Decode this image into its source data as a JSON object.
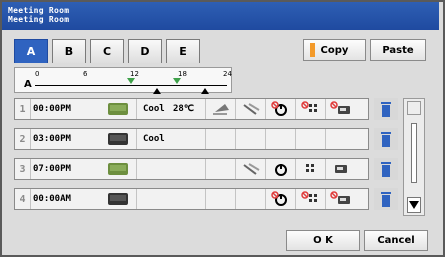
{
  "window": {
    "title_line1": "Meeting Room",
    "title_line2": "Meeting Room"
  },
  "tabs": [
    {
      "label": "A",
      "selected": true
    },
    {
      "label": "B",
      "selected": false
    },
    {
      "label": "C",
      "selected": false
    },
    {
      "label": "D",
      "selected": false
    },
    {
      "label": "E",
      "selected": false
    }
  ],
  "toolbar": {
    "copy_label": "Copy",
    "paste_label": "Paste"
  },
  "timeline": {
    "label": "A",
    "ticks": [
      "0",
      "6",
      "12",
      "18",
      "24"
    ]
  },
  "schedule": [
    {
      "index": "1",
      "time": "00:00PM",
      "mode": "Cool",
      "temp": "28℃"
    },
    {
      "index": "2",
      "time": "03:00PM",
      "mode": "Cool",
      "temp": ""
    },
    {
      "index": "3",
      "time": "07:00PM",
      "mode": "",
      "temp": ""
    },
    {
      "index": "4",
      "time": "00:00AM",
      "mode": "",
      "temp": ""
    }
  ],
  "footer": {
    "ok_label": "O K",
    "cancel_label": "Cancel"
  },
  "colors": {
    "title_bar": "#2e5fb4",
    "tab_selected": "#2f63c0",
    "trash": "#2f63c0",
    "copy_accent": "#f39a2a"
  }
}
